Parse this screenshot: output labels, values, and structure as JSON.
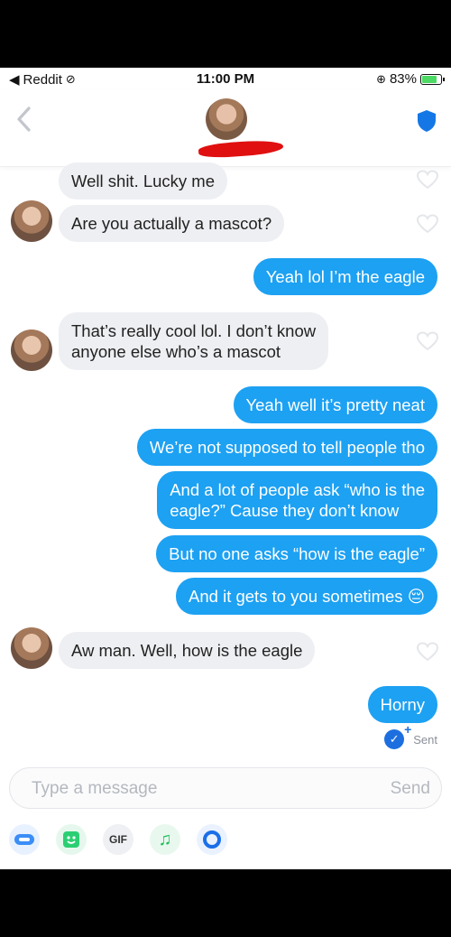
{
  "status_bar": {
    "back_app": "Reddit",
    "time": "11:00 PM",
    "battery": "83%",
    "battery_level": 0.83
  },
  "colors": {
    "outgoing": "#1da1f2",
    "incoming": "#eeeff2",
    "redaction": "#e01010"
  },
  "messages": [
    {
      "from": "them",
      "text": "Well shit. Lucky me"
    },
    {
      "from": "them",
      "text": "Are you actually a mascot?"
    },
    {
      "from": "me",
      "text": "Yeah lol I’m the eagle"
    },
    {
      "from": "them",
      "text_line1": "That’s really cool lol. I don’t know",
      "text_line2": "anyone else who’s a mascot"
    },
    {
      "from": "me",
      "text": "Yeah well it’s pretty neat"
    },
    {
      "from": "me",
      "text": "We’re not supposed to tell people tho"
    },
    {
      "from": "me",
      "text_line1": "And a lot of people ask “who is the",
      "text_line2": "eagle?” Cause they don’t know"
    },
    {
      "from": "me",
      "text": "But no one asks “how is the eagle”"
    },
    {
      "from": "me",
      "text": "And it gets to you sometimes 😔"
    },
    {
      "from": "them",
      "text": "Aw man. Well, how is the eagle"
    },
    {
      "from": "me",
      "text": "Horny"
    }
  ],
  "sent_status": "Sent",
  "composer": {
    "placeholder": "Type a message",
    "send_label": "Send"
  },
  "tools": {
    "gif_label": "GIF"
  },
  "icons": [
    "back-chevron-icon",
    "shield-icon",
    "heart-icon",
    "sent-check-icon",
    "keyboard-icon",
    "sticker-icon",
    "gif-icon",
    "music-icon",
    "loop-icon"
  ]
}
